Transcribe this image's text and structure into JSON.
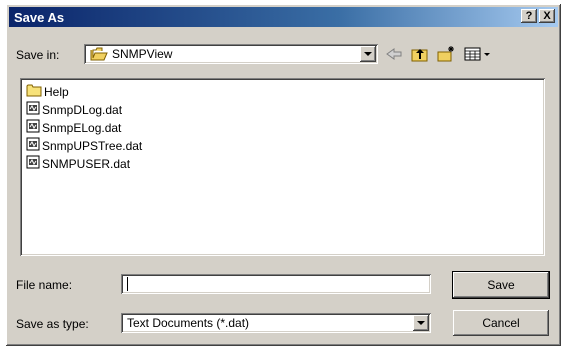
{
  "dialog": {
    "title": "Save As",
    "help_glyph": "?",
    "close_glyph": "X"
  },
  "toolbar": {
    "save_in_label": "Save in:",
    "location": "SNMPView",
    "location_icon": "folder-open-icon",
    "back_icon": "back-arrow-icon",
    "up_icon": "up-folder-icon",
    "new_folder_icon": "new-folder-icon",
    "view_icon": "view-menu-icon"
  },
  "files": [
    {
      "name": "Help",
      "icon": "folder-icon"
    },
    {
      "name": "SnmpDLog.dat",
      "icon": "file-icon"
    },
    {
      "name": "SnmpELog.dat",
      "icon": "file-icon"
    },
    {
      "name": "SnmpUPSTree.dat",
      "icon": "file-icon"
    },
    {
      "name": "SNMPUSER.dat",
      "icon": "file-icon"
    }
  ],
  "form": {
    "file_name_label": "File name:",
    "file_name_value": "",
    "save_as_type_label": "Save as type:",
    "save_as_type_value": "Text Documents (*.dat)",
    "save_label": "Save",
    "cancel_label": "Cancel"
  }
}
